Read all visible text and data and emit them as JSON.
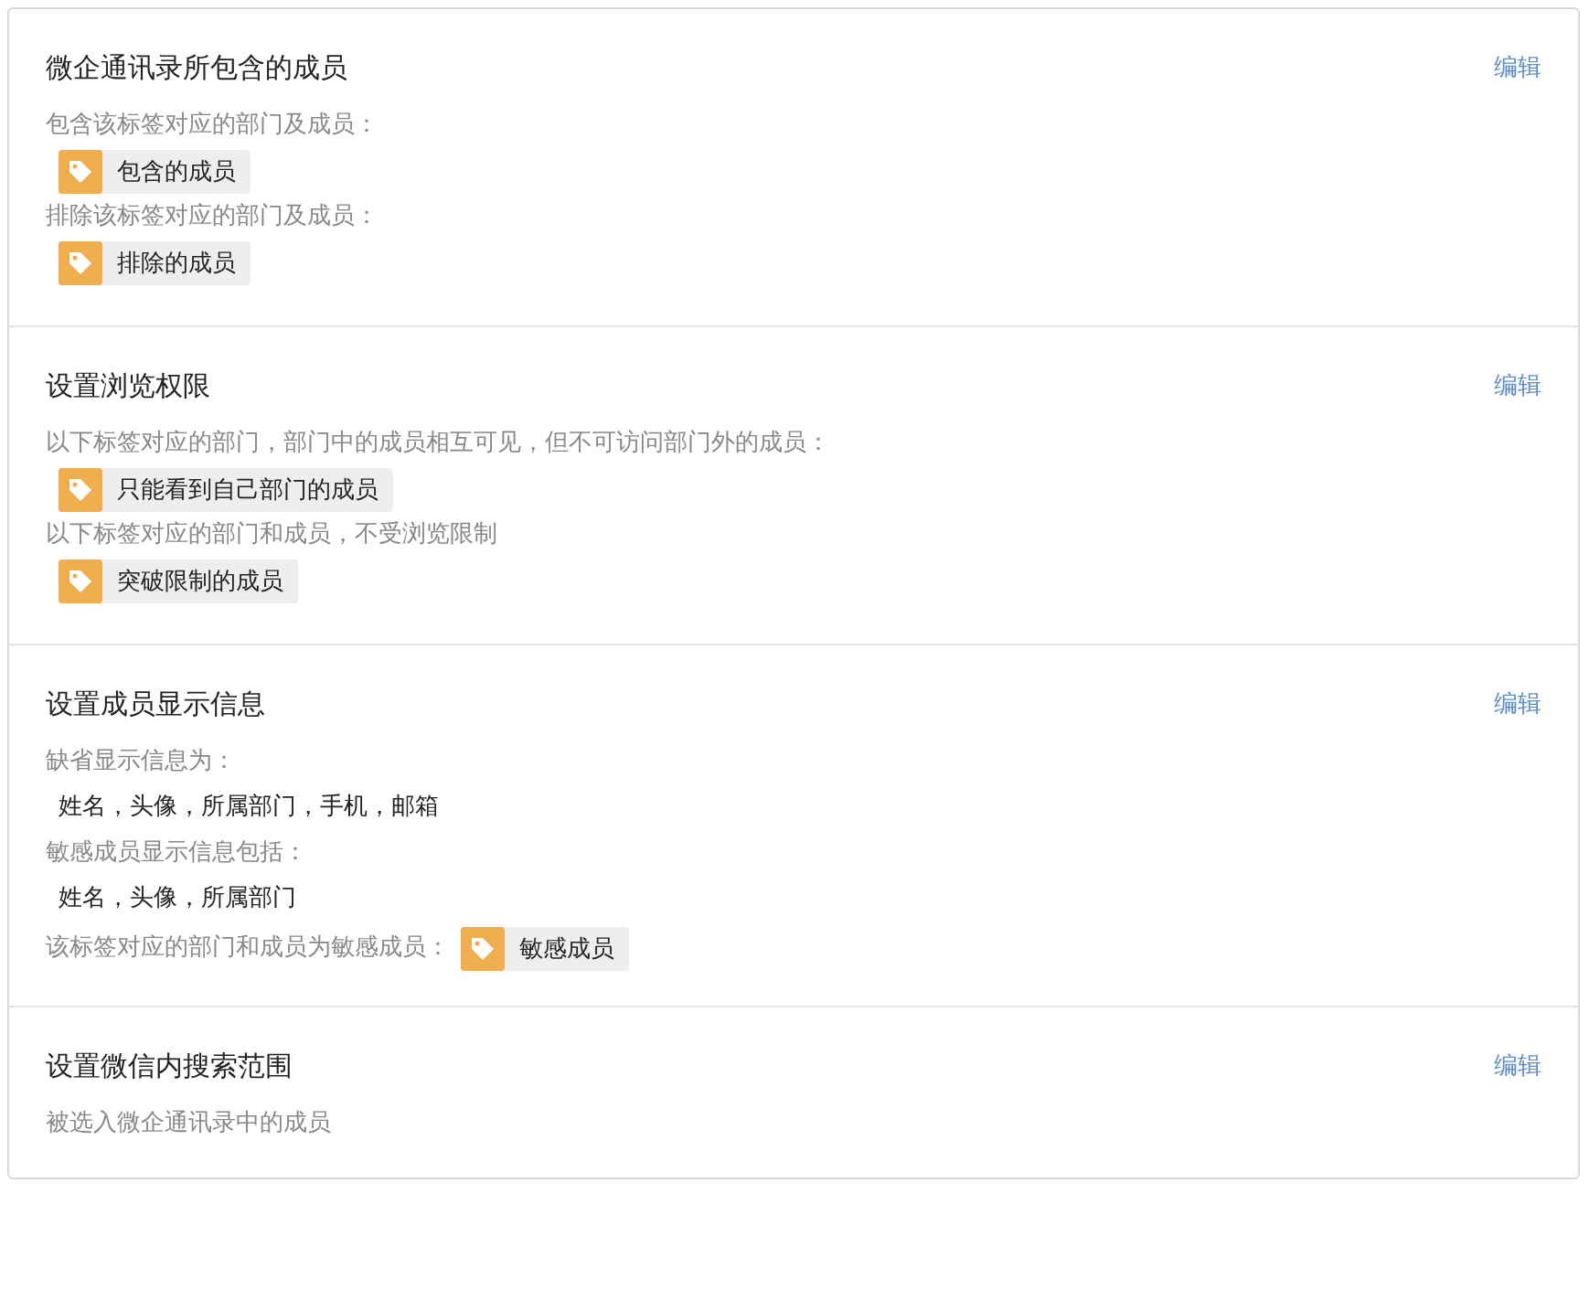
{
  "sections": [
    {
      "title": "微企通讯录所包含的成员",
      "edit": "编辑",
      "items": [
        {
          "kind": "label",
          "text": "包含该标签对应的部门及成员："
        },
        {
          "kind": "tag",
          "text": "包含的成员"
        },
        {
          "kind": "label",
          "text": "排除该标签对应的部门及成员："
        },
        {
          "kind": "tag",
          "text": "排除的成员"
        }
      ]
    },
    {
      "title": "设置浏览权限",
      "edit": "编辑",
      "items": [
        {
          "kind": "label",
          "text": "以下标签对应的部门，部门中的成员相互可见，但不可访问部门外的成员："
        },
        {
          "kind": "tag",
          "text": "只能看到自己部门的成员"
        },
        {
          "kind": "label",
          "text": "以下标签对应的部门和成员，不受浏览限制"
        },
        {
          "kind": "tag",
          "text": "突破限制的成员"
        }
      ]
    },
    {
      "title": "设置成员显示信息",
      "edit": "编辑",
      "items": [
        {
          "kind": "label",
          "text": "缺省显示信息为："
        },
        {
          "kind": "value",
          "text": "姓名，头像，所属部门，手机，邮箱"
        },
        {
          "kind": "label",
          "text": "敏感成员显示信息包括："
        },
        {
          "kind": "value",
          "text": "姓名，头像，所属部门"
        },
        {
          "kind": "label_tag",
          "text": "该标签对应的部门和成员为敏感成员：",
          "tag": "敏感成员"
        }
      ]
    },
    {
      "title": "设置微信内搜索范围",
      "edit": "编辑",
      "items": [
        {
          "kind": "label",
          "text": "被选入微企通讯录中的成员"
        }
      ]
    }
  ]
}
